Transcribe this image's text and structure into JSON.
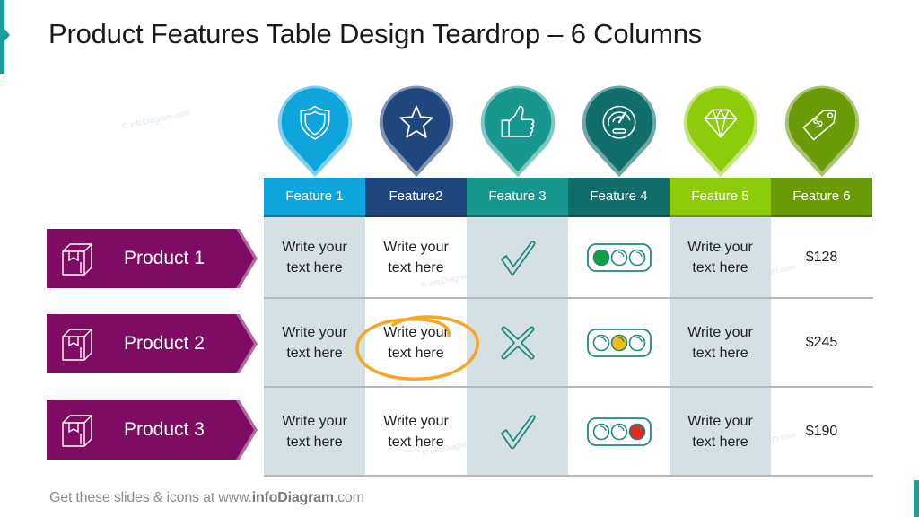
{
  "title": "Product Features Table Design Teardrop – 6 Columns",
  "watermark": "© infoDiagram.com",
  "footer": {
    "prefix": "Get these slides & icons at www.",
    "brand": "infoDiagram",
    "suffix": ".com"
  },
  "features": [
    {
      "label": "Feature 1",
      "icon": "shield-icon",
      "color": "#0ea5dc",
      "ring": "#7fd0ef"
    },
    {
      "label": "Feature2",
      "icon": "star-icon",
      "color": "#1f477e",
      "ring": "#7e93b5"
    },
    {
      "label": "Feature 3",
      "icon": "thumbs-up-icon",
      "color": "#17978e",
      "ring": "#7fc9c3"
    },
    {
      "label": "Feature 4",
      "icon": "speedometer-icon",
      "color": "#116e6a",
      "ring": "#6fa7a4"
    },
    {
      "label": "Feature 5",
      "icon": "diamond-icon",
      "color": "#8dcc0a",
      "ring": "#c3e57c"
    },
    {
      "label": "Feature 6",
      "icon": "price-tag-icon",
      "color": "#6a9a08",
      "ring": "#a8c56e"
    }
  ],
  "products": [
    {
      "label": "Product 1",
      "cells": {
        "f1": "Write your\ntext here",
        "f2": "Write your\ntext here",
        "f3": "check",
        "f4": "green",
        "f5": "Write your\ntext here",
        "f6": "$128"
      }
    },
    {
      "label": "Product 2",
      "cells": {
        "f1": "Write your\ntext here",
        "f2": "Write your\ntext here",
        "f3": "cross",
        "f4": "yellow",
        "f5": "Write your\ntext here",
        "f6": "$245"
      },
      "highlighted": "f2"
    },
    {
      "label": "Product 3",
      "cells": {
        "f1": "Write your\ntext here",
        "f2": "Write your\ntext here",
        "f3": "check",
        "f4": "red",
        "f5": "Write your\ntext here",
        "f6": "$190"
      }
    }
  ],
  "colors": {
    "product_band": "#7d0c62",
    "product_tip": "#b06aa0",
    "shade": "#d5e0e5",
    "accent": "#1a9e96",
    "highlight_circle": "#f5a623",
    "icon_stroke": "#1f8a80",
    "light_green": "#11a23c",
    "light_yellow": "#f4bb12",
    "light_red": "#e8261c"
  }
}
